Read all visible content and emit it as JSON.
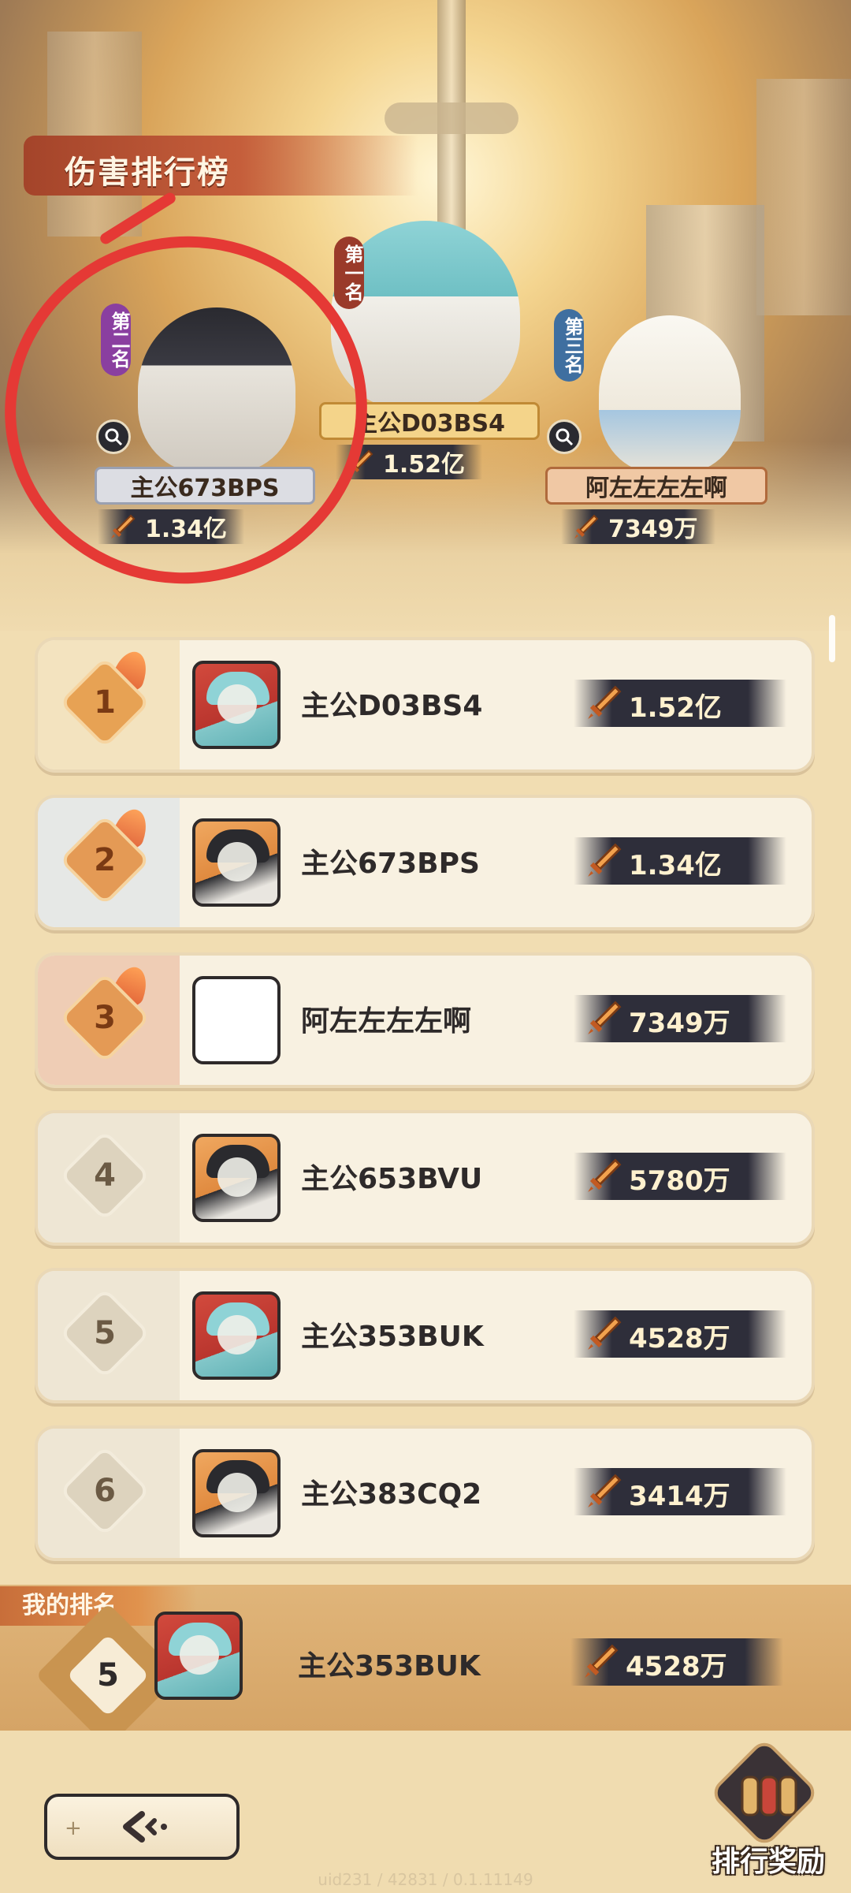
{
  "title": "伤害排行榜",
  "podium": [
    {
      "rank_label": "第二名",
      "name": "主公673BPS",
      "score": "1.34亿"
    },
    {
      "rank_label": "第一名",
      "name": "主公D03BS4",
      "score": "1.52亿"
    },
    {
      "rank_label": "第三名",
      "name": "阿左左左左啊",
      "score": "7349万"
    }
  ],
  "rows": [
    {
      "rank": "1",
      "name": "主公D03BS4",
      "score": "1.52亿"
    },
    {
      "rank": "2",
      "name": "主公673BPS",
      "score": "1.34亿"
    },
    {
      "rank": "3",
      "name": "阿左左左左啊",
      "score": "7349万"
    },
    {
      "rank": "4",
      "name": "主公653BVU",
      "score": "5780万"
    },
    {
      "rank": "5",
      "name": "主公353BUK",
      "score": "4528万"
    },
    {
      "rank": "6",
      "name": "主公383CQ2",
      "score": "3414万"
    }
  ],
  "my_rank": {
    "label": "我的排名",
    "rank": "5",
    "name": "主公353BUK",
    "score": "4528万"
  },
  "bottom": {
    "reward_label": "排行奖励",
    "footer": "uid231 / 42831 / 0.1.11149"
  },
  "colors": {
    "annotation": "#e53935",
    "title_banner": "#a4442a",
    "score_plate": "#2e2e3a"
  }
}
